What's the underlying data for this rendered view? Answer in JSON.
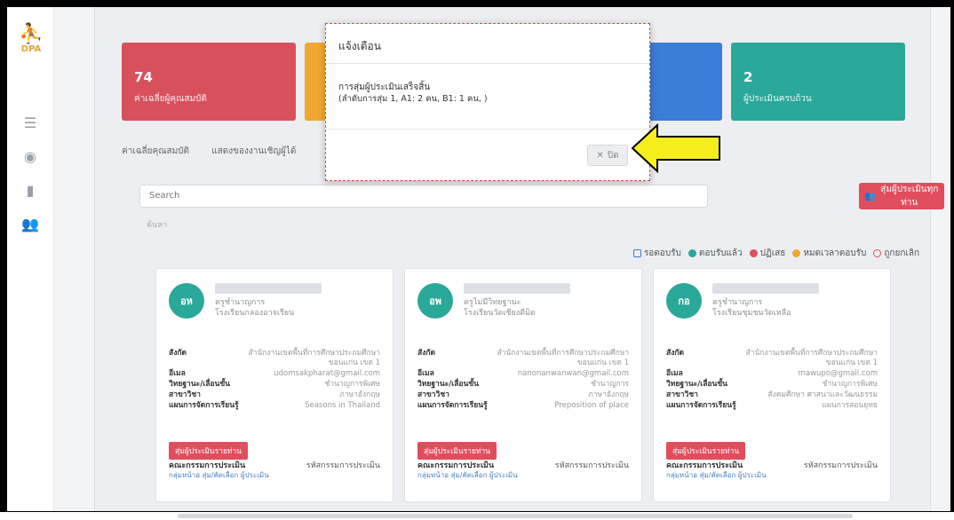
{
  "sidebar": {
    "logo_text": "DPA",
    "icons": [
      "list-icon",
      "user-circle-icon",
      "document-icon",
      "users-icon"
    ]
  },
  "stats": [
    {
      "value": "74",
      "label": "ค่าเฉลี่ยผู้คุณสมบัติ",
      "color": "#d9505d"
    },
    {
      "value": "",
      "label": "",
      "color": "#f0a830"
    },
    {
      "value": "",
      "label": "",
      "color": "#3b7dd8"
    },
    {
      "value": "2",
      "label": "ผู้ประเมินครบถ้วน",
      "color": "#2aa89a"
    }
  ],
  "tabs": [
    "ค่าเฉลี่ยคุณสมบัติ",
    "แสดงของงานเชิญผู้ได้"
  ],
  "search": {
    "placeholder": "Search",
    "label": "ค้นหา"
  },
  "random_button": "สุ่มผู้ประเมินทุกท่าน",
  "legend": [
    {
      "label": "รอตอบรับ",
      "color": "#3b7dd8",
      "shape": "square"
    },
    {
      "label": "ตอบรับแล้ว",
      "color": "#2aa89a",
      "shape": "circle"
    },
    {
      "label": "ปฏิเสธ",
      "color": "#e04e5d",
      "shape": "circle"
    },
    {
      "label": "หมดเวลาตอบรับ",
      "color": "#f0a830",
      "shape": "circle"
    },
    {
      "label": "ถูกยกเลิก",
      "color": "#e04e5d",
      "shape": "ban"
    }
  ],
  "cards": [
    {
      "initials": "อห",
      "position": "ครูชำนาญการ",
      "school": "โรงเรียนกลองอาจเรียน",
      "rows": [
        {
          "k": "สังกัด",
          "v": "สำนักงานเขตพื้นที่การศึกษาประถมศึกษาขอนแก่น เขต 1"
        },
        {
          "k": "อีเมล",
          "v": "udomsakpharat@gmail.com"
        },
        {
          "k": "วิทยฐานะ/เลื่อนขั้น",
          "v": "ชำนาญการพิเศษ"
        },
        {
          "k": "สาขาวิชา",
          "v": "ภาษาอังกฤษ"
        },
        {
          "k": "แผนการจัดการเรียนรู้",
          "v": "Seasons in Thailand"
        }
      ],
      "btn": "สุ่มผู้ประเมินรายท่าน",
      "foot_k": "คณะกรรมการประเมิน",
      "foot_r": "รหัสกรรมการประเมิน",
      "link": "กลุ่มหน้าอ สุ่ม/คัดเลือก ผู้ประเมิน"
    },
    {
      "initials": "อพ",
      "position": "ครูไม่มีวิทยฐานะ",
      "school": "โรงเรียนวัดเชียงดีมิด",
      "rows": [
        {
          "k": "สังกัด",
          "v": "สำนักงานเขตพื้นที่การศึกษาประถมศึกษาขอนแก่น เขต 1"
        },
        {
          "k": "อีเมล",
          "v": "nanonanwanwan@gmail.com"
        },
        {
          "k": "วิทยฐานะ/เลื่อนขั้น",
          "v": "ชำนาญการ"
        },
        {
          "k": "สาขาวิชา",
          "v": "ภาษาอังกฤษ"
        },
        {
          "k": "แผนการจัดการเรียนรู้",
          "v": "Preposition of place"
        }
      ],
      "btn": "สุ่มผู้ประเมินรายท่าน",
      "foot_k": "คณะกรรมการประเมิน",
      "foot_r": "รหัสกรรมการประเมิน",
      "link": "กลุ่มหน้าอ สุ่ม/คัดเลือก ผู้ประเมิน"
    },
    {
      "initials": "กอ",
      "position": "ครูชำนาญการ",
      "school": "โรงเรียนชุมชนวัดเหลือ",
      "rows": [
        {
          "k": "สังกัด",
          "v": "สำนักงานเขตพื้นที่การศึกษาประถมศึกษาขอนแก่น เขต 1"
        },
        {
          "k": "อีเมล",
          "v": "rnawupo@gmail.com"
        },
        {
          "k": "วิทยฐานะ/เลื่อนขั้น",
          "v": "ชำนาญการพิเศษ"
        },
        {
          "k": "สาขาวิชา",
          "v": "สังคมศึกษา ศาสนาและวัฒนธรรม"
        },
        {
          "k": "แผนการจัดการเรียนรู้",
          "v": "แผนการสอนยุทธ"
        }
      ],
      "btn": "สุ่มผู้ประเมินรายท่าน",
      "foot_k": "คณะกรรมการประเมิน",
      "foot_r": "รหัสกรรมการประเมิน",
      "link": "กลุ่มหน้าอ สุ่ม/คัดเลือก ผู้ประเมิน"
    }
  ],
  "modal": {
    "title": "แจ้งเตือน",
    "message": "การสุ่มผู้ประเมินเสร็จสิ้น",
    "detail": "(ลำดับการสุ่ม 1, A1: 2 คน, B1: 1 คน, )",
    "close_label": "ปิด"
  },
  "colors": {
    "arrow": "#f5ee1e",
    "accent_red": "#e04e5d",
    "teal": "#2aa89a"
  }
}
